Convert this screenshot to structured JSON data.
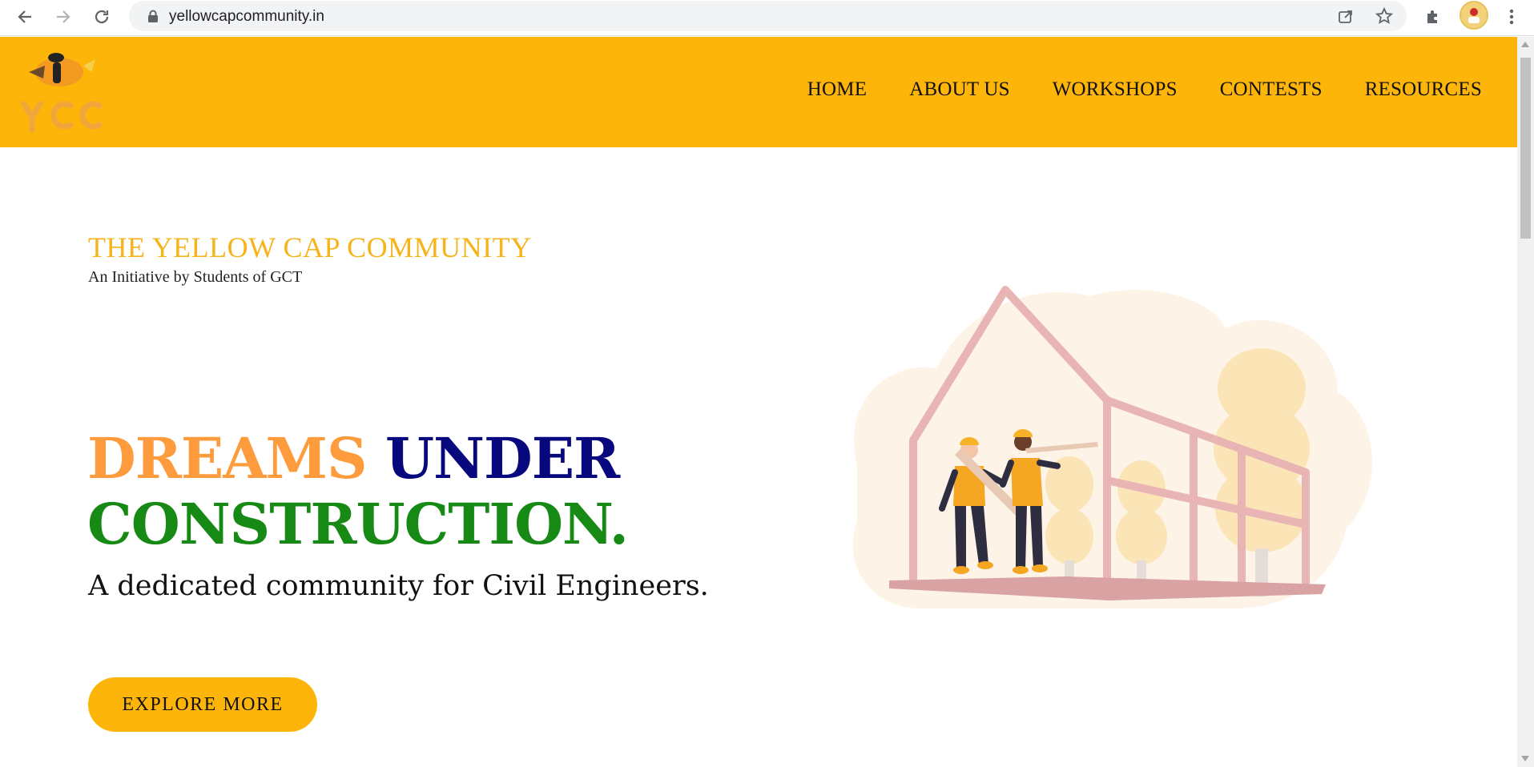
{
  "browser": {
    "url": "yellowcapcommunity.in",
    "icons": [
      "back-arrow-icon",
      "forward-arrow-icon",
      "reload-icon",
      "lock-icon",
      "share-icon",
      "star-icon",
      "extensions-icon",
      "profile-avatar",
      "more-icon"
    ]
  },
  "site": {
    "nav": {
      "items": [
        {
          "label": "HOME"
        },
        {
          "label": "ABOUT US"
        },
        {
          "label": "WORKSHOPS"
        },
        {
          "label": "CONTESTS"
        },
        {
          "label": "RESOURCES"
        }
      ]
    },
    "logo": {
      "text": "YCC"
    }
  },
  "hero": {
    "brand_title": "THE YELLOW CAP COMMUNITY",
    "brand_subtitle": "An Initiative by Students of GCT",
    "headline": {
      "word1": "DREAMS",
      "word2": "UNDER",
      "word3": "CONSTRUCTION."
    },
    "tagline": "A dedicated community for Civil Engineers.",
    "cta_label": "EXPLORE MORE"
  },
  "colors": {
    "header_bg": "#fdb50a",
    "brand_title": "#f7b31a",
    "dreams": "#fe9b3c",
    "under": "#07077e",
    "construction": "#168a15",
    "cta_bg": "#fdb50a"
  }
}
